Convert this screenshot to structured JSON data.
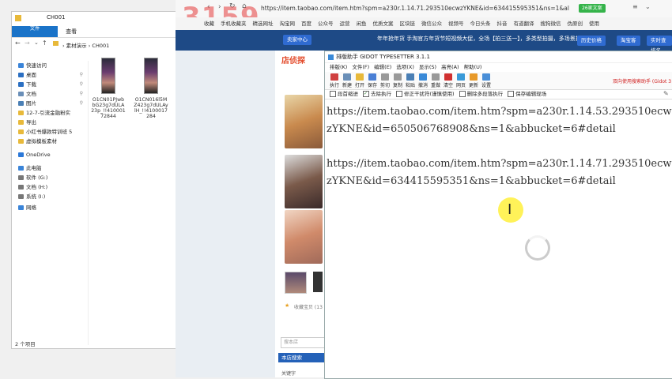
{
  "explorer": {
    "title": "CH001",
    "ribbon_tabs": [
      "文件",
      "主页",
      "共享",
      "查看"
    ],
    "breadcrumb": [
      "素材演示",
      "CH001"
    ],
    "nav_items": [
      {
        "label": "快速访问",
        "icon": "star-icon",
        "color": "#3a84d8",
        "pinned": false
      },
      {
        "label": "桌面",
        "icon": "desktop-icon",
        "color": "#2b6fc2",
        "pinned": true
      },
      {
        "label": "下载",
        "icon": "download-icon",
        "color": "#2b6fc2",
        "pinned": true
      },
      {
        "label": "文档",
        "icon": "document-icon",
        "color": "#6a8fb8",
        "pinned": true
      },
      {
        "label": "图片",
        "icon": "picture-icon",
        "color": "#4a7fb5",
        "pinned": true
      },
      {
        "label": "12-7-引流金融粉实",
        "icon": "folder-icon",
        "color": "#e8b93a",
        "pinned": false
      },
      {
        "label": "导出",
        "icon": "folder-icon",
        "color": "#e8b93a",
        "pinned": false
      },
      {
        "label": "小红书爆款特训班 5",
        "icon": "folder-icon",
        "color": "#e8b93a",
        "pinned": false
      },
      {
        "label": "虚拟模板素材",
        "icon": "folder-icon",
        "color": "#e8b93a",
        "pinned": false
      },
      {
        "label": "OneDrive",
        "icon": "cloud-icon",
        "color": "#2b78d8",
        "pinned": false
      },
      {
        "label": "此电脑",
        "icon": "computer-icon",
        "color": "#3a84d8",
        "pinned": false
      },
      {
        "label": "软件 (G:)",
        "icon": "drive-icon",
        "color": "#777777",
        "pinned": false
      },
      {
        "label": "文档 (H:)",
        "icon": "drive-icon",
        "color": "#777777",
        "pinned": false
      },
      {
        "label": "系统 (I:)",
        "icon": "drive-icon",
        "color": "#777777",
        "pinned": false
      },
      {
        "label": "网络",
        "icon": "network-icon",
        "color": "#3a84d8",
        "pinned": false
      }
    ],
    "files": [
      {
        "name": "O1CN01PJwbbG23g7dULA23p_!!41000172844"
      },
      {
        "name": "O1CN016l5MZ423g7dULAylH_!!4100017284"
      }
    ],
    "status": "2 个项目"
  },
  "browser": {
    "watermark": "3159",
    "url": "item.taobao.com/item.htm?spm=a230r.1.14.71.293510ecwzYKNE&id=634415595351&ns=1&al",
    "url_prefix": "https://",
    "badge": "26家文案",
    "bookmarks": [
      "收藏",
      "手机收藏夹",
      "精选网址",
      "淘宝网",
      "百度",
      "公众号",
      "运营",
      "闲鱼",
      "优质文案",
      "区块链",
      "微信公众",
      "视频号",
      "今日头条",
      "抖音",
      "有道翻译",
      "搜狗微信",
      "伪原创",
      "使用"
    ],
    "promo_text": "年年抢年货 手淘官方年货节短视频大促，全场【拍三送一】，多类型拍摄，多场景投放",
    "top_buttons": [
      "卖家中心",
      "历史价格",
      "淘宝客",
      "实时查排名"
    ],
    "shop_logo": "店侦探",
    "search_placeholder": "搜本店",
    "shop_search_label": "本店搜索",
    "side_label": "关键字",
    "favorite_label": "收藏宝贝 (13"
  },
  "gidot": {
    "title": "排版助手 GIDOT TYPESETTER 3.1.1",
    "menu": [
      "排版(K)",
      "文件(F)",
      "编辑(E)",
      "选项(X)",
      "显示(S)",
      "高亮(A)",
      "帮助(U)"
    ],
    "tools": [
      "执行",
      "新建",
      "打开",
      "保存",
      "剪切",
      "复制",
      "粘贴",
      "撤消",
      "重做",
      "清空",
      "网页",
      "更新",
      "设置"
    ],
    "promo": "双向使用搜索助手 (Gidot 3",
    "options": [
      "段首缩进",
      "去除执行",
      "修正干扰符(谨慎使用)",
      "删除多段落执行",
      "保存编辑现场"
    ],
    "option_checked": [
      false,
      true,
      false,
      false,
      false
    ],
    "paragraphs": [
      "https://item.taobao.com/item.htm?spm=a230r.1.14.53.293510ecwzYKNE&id=650506768908&ns=1&abbucket=6#detail",
      "https://item.taobao.com/item.htm?spm=a230r.1.14.71.293510ecwzYKNE&id=634415595351&ns=1&abbucket=6#detail"
    ]
  }
}
